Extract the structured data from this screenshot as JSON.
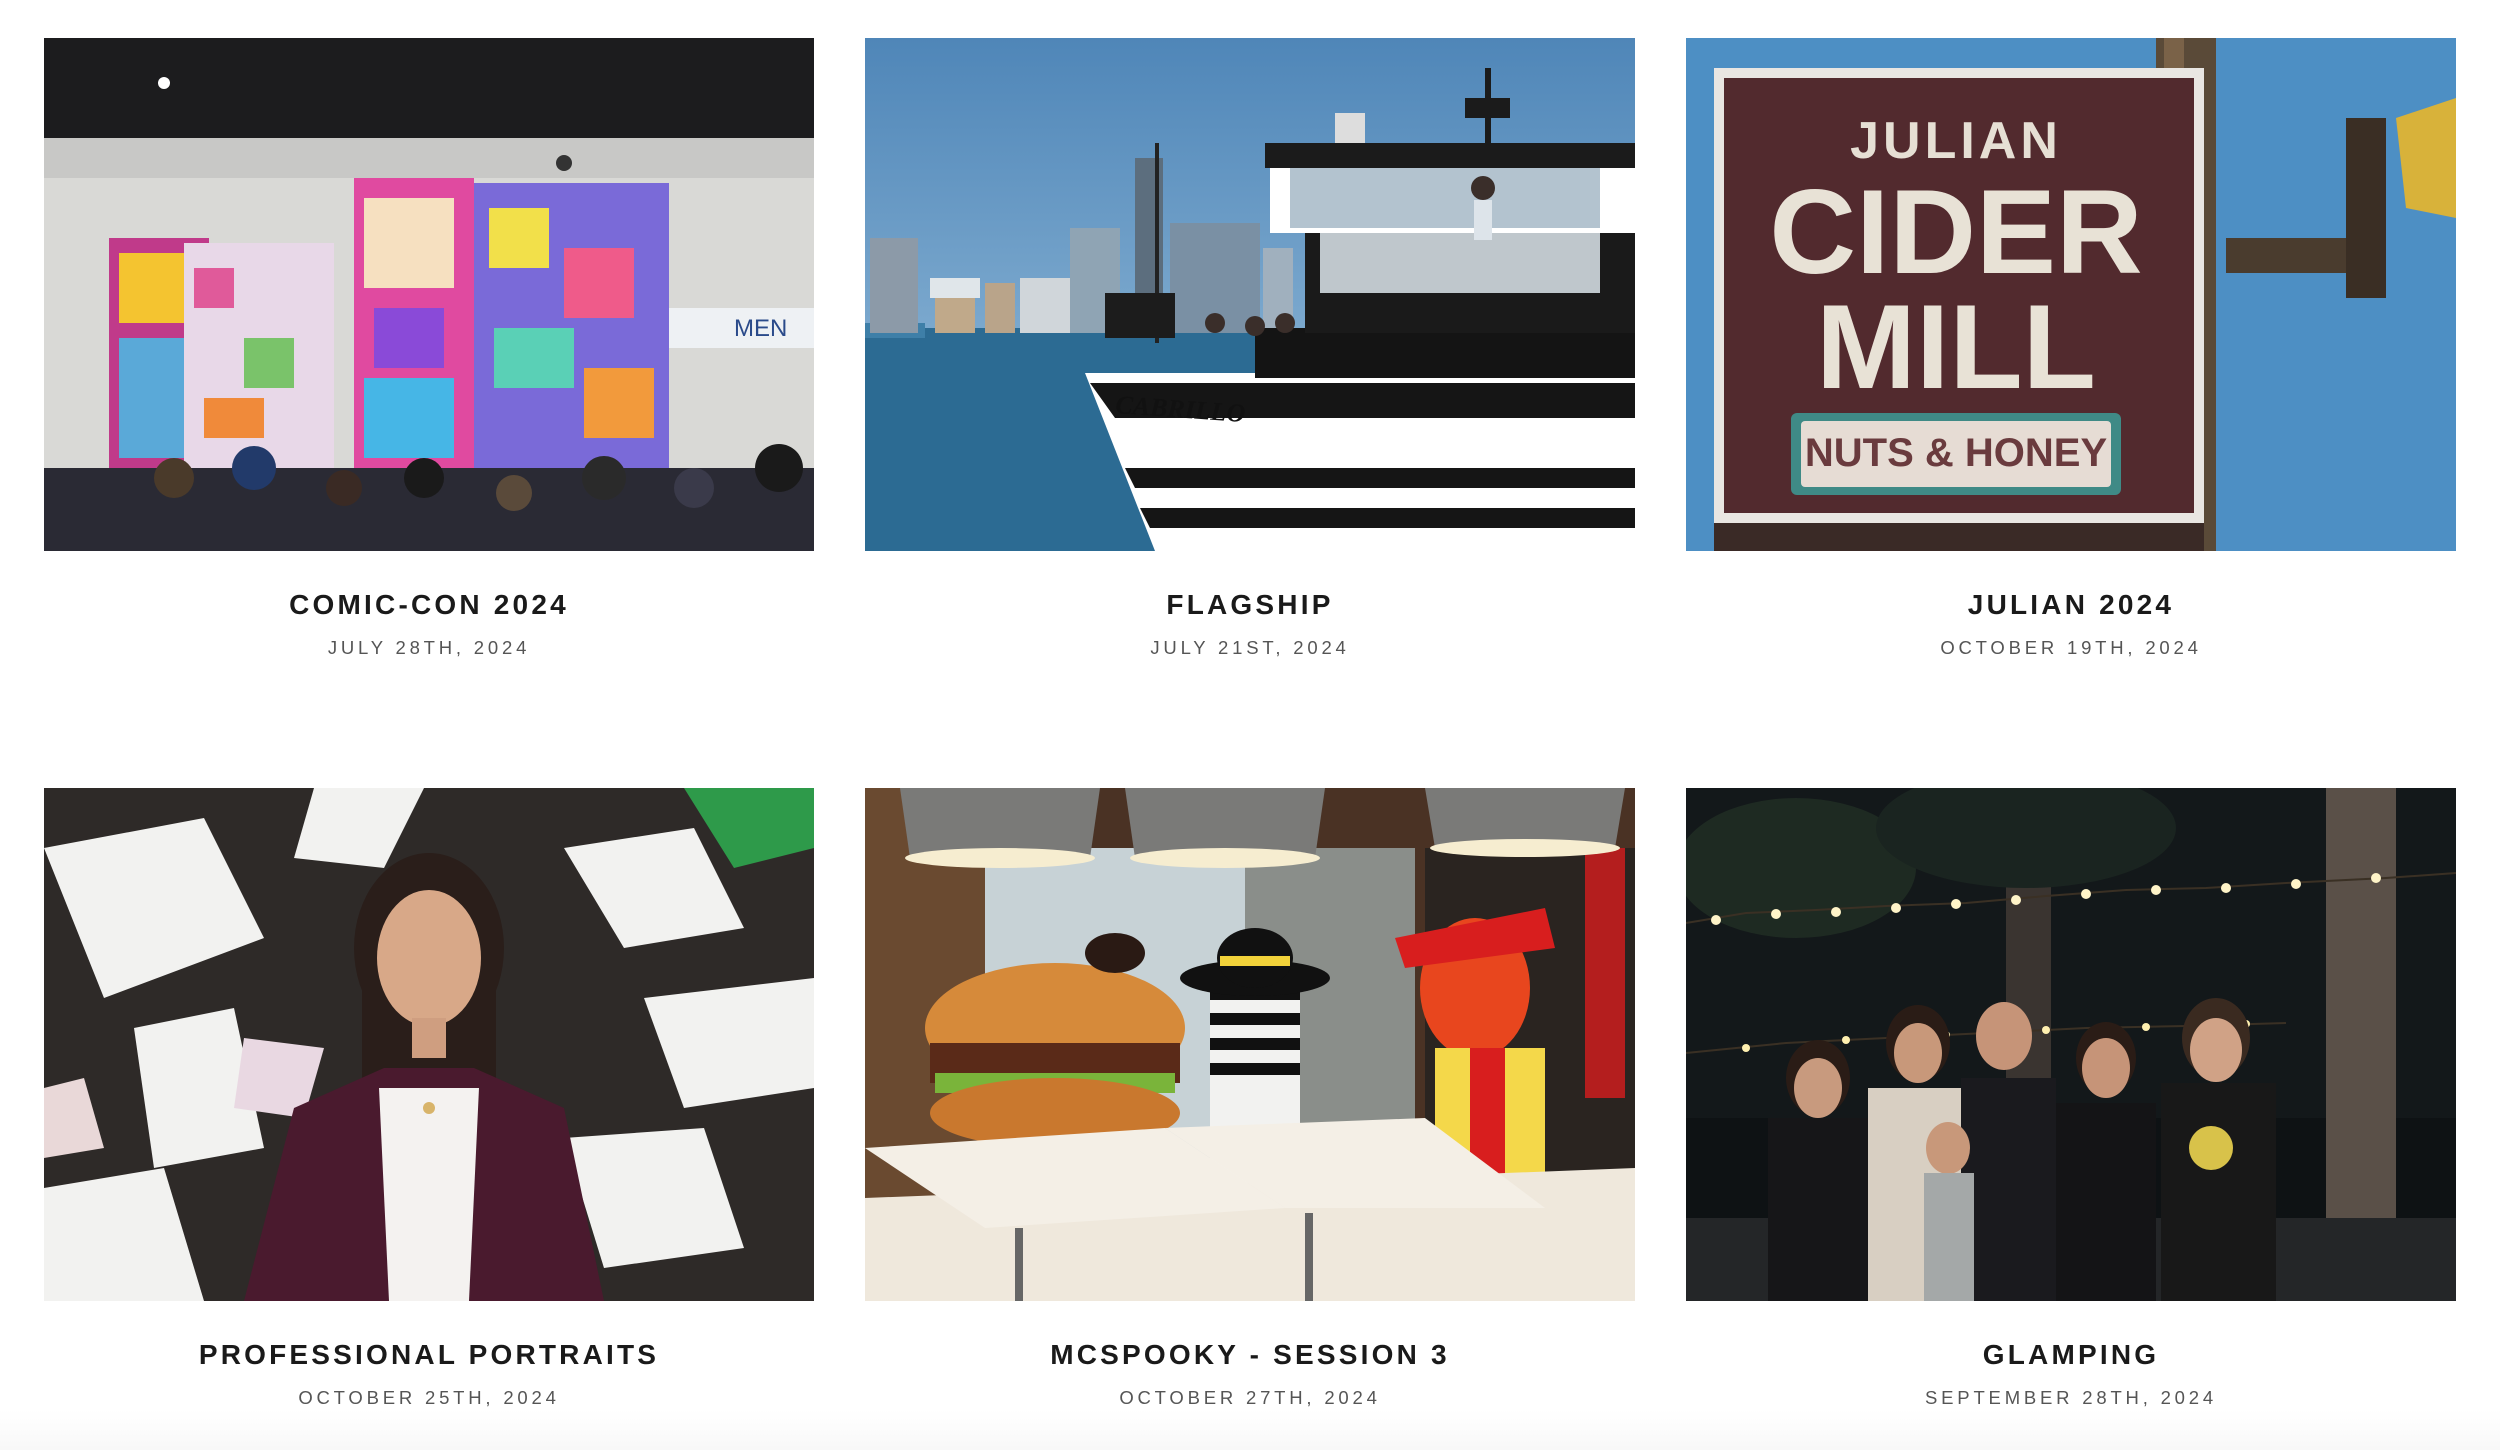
{
  "gallery": {
    "items": [
      {
        "title": "COMIC-CON 2024",
        "date": "JULY 28TH, 2024",
        "image": "convention-hall-photo",
        "sign_text": "MEN"
      },
      {
        "title": "FLAGSHIP",
        "date": "JULY 21ST, 2024",
        "image": "harbor-boat-photo",
        "boat_name": "CABRILLO"
      },
      {
        "title": "JULIAN 2024",
        "date": "OCTOBER 19TH, 2024",
        "image": "cider-mill-sign-photo",
        "sign_line1": "JULIAN",
        "sign_line2": "CIDER",
        "sign_line3": "MILL",
        "sign_line4": "NUTS & HONEY"
      },
      {
        "title": "PROFESSIONAL PORTRAITS",
        "date": "OCTOBER 25TH, 2024",
        "image": "portrait-mural-photo"
      },
      {
        "title": "MCSPOOKY - SESSION 3",
        "date": "OCTOBER 27TH, 2024",
        "image": "costume-restaurant-photo"
      },
      {
        "title": "GLAMPING",
        "date": "SEPTEMBER 28TH, 2024",
        "image": "family-string-lights-photo"
      }
    ]
  },
  "colors": {
    "title": "#1a1a1a",
    "date": "#555555",
    "background": "#ffffff"
  }
}
